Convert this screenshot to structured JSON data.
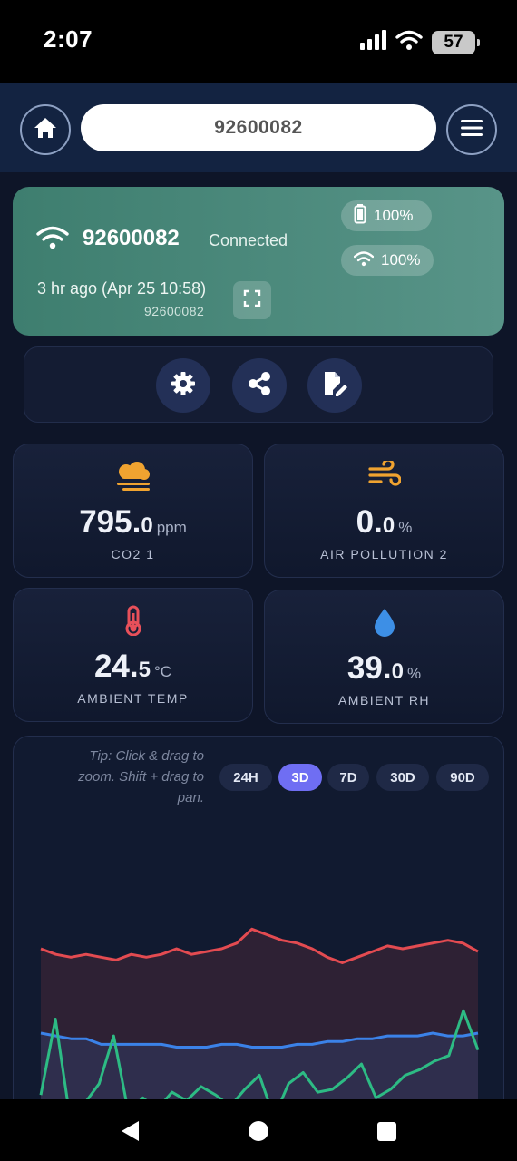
{
  "status_bar": {
    "time": "2:07",
    "battery": "57"
  },
  "header": {
    "device_id": "92600082"
  },
  "device_card": {
    "device_id": "92600082",
    "status": "Connected",
    "last_seen": "3 hr ago (Apr 25 10:58)",
    "sub_id": "92600082",
    "battery_level": "100%",
    "signal_level": "100%"
  },
  "actions": [
    "settings",
    "share",
    "edit-document"
  ],
  "metrics": [
    {
      "int": "795.",
      "dec": "0",
      "unit": "ppm",
      "label": "CO2 1",
      "color": "#f0a330"
    },
    {
      "int": "0.",
      "dec": "0",
      "unit": "%",
      "label": "AIR POLLUTION 2",
      "color": "#f0a330"
    },
    {
      "int": "24.",
      "dec": "5",
      "unit": "°C",
      "label": "AMBIENT TEMP",
      "color": "#e8505a"
    },
    {
      "int": "39.",
      "dec": "0",
      "unit": "%",
      "label": "AMBIENT RH",
      "color": "#3d8fe6"
    }
  ],
  "chart": {
    "tip": "Tip: Click & drag to zoom. Shift + drag to pan.",
    "ranges": [
      "24H",
      "3D",
      "7D",
      "30D",
      "90D"
    ],
    "active_range": "3D"
  },
  "chart_data": {
    "type": "line",
    "title": "",
    "xlabel": "",
    "ylabel": "",
    "grid": false,
    "series": [
      {
        "color": "#e34b51",
        "fill": true,
        "values": [
          40,
          42,
          43,
          42,
          43,
          44,
          42,
          43,
          42,
          40,
          42,
          41,
          40,
          38,
          33,
          35,
          37,
          38,
          40,
          43,
          45,
          43,
          41,
          39,
          40,
          39,
          38,
          37,
          38,
          41
        ]
      },
      {
        "color": "#3b82e8",
        "fill": true,
        "values": [
          70,
          71,
          72,
          72,
          74,
          74,
          74,
          74,
          74,
          75,
          75,
          75,
          74,
          74,
          75,
          75,
          75,
          74,
          74,
          73,
          73,
          72,
          72,
          71,
          71,
          71,
          70,
          71,
          71,
          70
        ]
      },
      {
        "color": "#2dbb84",
        "fill": false,
        "values": [
          92,
          65,
          100,
          95,
          88,
          71,
          98,
          93,
          97,
          91,
          94,
          89,
          92,
          96,
          90,
          85,
          100,
          88,
          84,
          91,
          90,
          86,
          81,
          93,
          90,
          85,
          83,
          80,
          78,
          62,
          76
        ]
      }
    ]
  }
}
